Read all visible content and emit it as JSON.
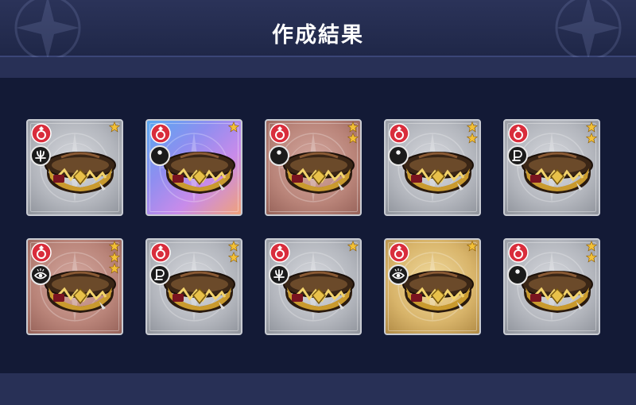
{
  "header": {
    "title": "作成結果"
  },
  "colors": {
    "silver": "#b9bcc3",
    "bronze": "#c08f86",
    "prism": "#9d8ee8",
    "gold": "#d8b46a",
    "badge_red": "#d92d3c",
    "star": "#f2c038"
  },
  "results": [
    {
      "frame": "silver",
      "affinity": "trident-icon",
      "stars": 1
    },
    {
      "frame": "prism",
      "affinity": "crescent-star-icon",
      "stars": 1
    },
    {
      "frame": "bronze",
      "affinity": "crescent-star-icon",
      "stars": 2
    },
    {
      "frame": "silver",
      "affinity": "crescent-star-icon",
      "stars": 2
    },
    {
      "frame": "silver",
      "affinity": "pluto-icon",
      "stars": 2
    },
    {
      "frame": "bronze",
      "affinity": "eye-icon",
      "stars": 3
    },
    {
      "frame": "silver",
      "affinity": "pluto-icon",
      "stars": 2
    },
    {
      "frame": "silver",
      "affinity": "trident-icon",
      "stars": 1
    },
    {
      "frame": "gold",
      "affinity": "eye-icon",
      "stars": 1
    },
    {
      "frame": "silver",
      "affinity": "crescent-star-icon",
      "stars": 2
    }
  ]
}
